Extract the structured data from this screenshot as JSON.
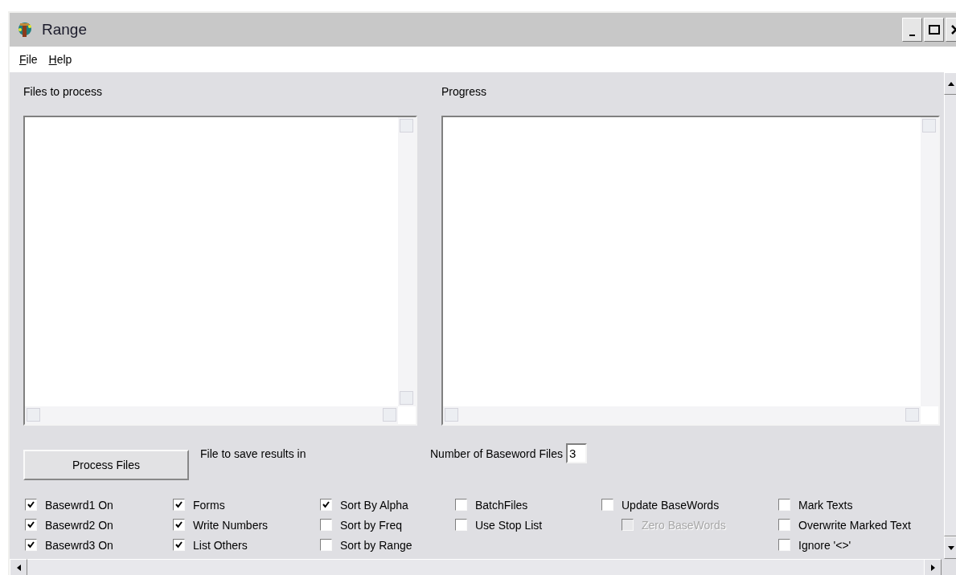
{
  "window": {
    "title": "Range"
  },
  "menu": [
    {
      "label": "File",
      "mnemonic_underlined": true
    },
    {
      "label": "Help",
      "mnemonic_underlined": true
    }
  ],
  "files_panel": {
    "label": "Files to process"
  },
  "progress_panel": {
    "label": "Progress"
  },
  "process_button": {
    "label": "Process Files"
  },
  "save_label": "File to save results in",
  "baseword_files": {
    "label": "Number of Baseword Files",
    "value": "3"
  },
  "option_columns": [
    [
      {
        "label": "Basewrd1 On",
        "checked": true,
        "disabled": false
      },
      {
        "label": "Basewrd2 On",
        "checked": true,
        "disabled": false
      },
      {
        "label": "Basewrd3 On",
        "checked": true,
        "disabled": false
      }
    ],
    [
      {
        "label": "Forms",
        "checked": true,
        "disabled": false
      },
      {
        "label": "Write Numbers",
        "checked": true,
        "disabled": false
      },
      {
        "label": "List Others",
        "checked": true,
        "disabled": false
      }
    ],
    [
      {
        "label": "Sort By Alpha",
        "checked": true,
        "disabled": false
      },
      {
        "label": "Sort by Freq",
        "checked": false,
        "disabled": false
      },
      {
        "label": "Sort by Range",
        "checked": false,
        "disabled": false
      }
    ],
    [
      {
        "label": "BatchFiles",
        "checked": false,
        "disabled": false
      },
      {
        "label": "Use Stop List",
        "checked": false,
        "disabled": false
      }
    ],
    [
      {
        "label": "Update BaseWords",
        "checked": false,
        "disabled": false,
        "children": [
          {
            "label": "Zero BaseWords",
            "checked": false,
            "disabled": true
          }
        ]
      }
    ],
    [
      {
        "label": "Mark Texts",
        "checked": false,
        "disabled": false
      },
      {
        "label": "Overwrite Marked Text",
        "checked": false,
        "disabled": false
      },
      {
        "label": "Ignore '<>'",
        "checked": false,
        "disabled": false
      }
    ]
  ]
}
